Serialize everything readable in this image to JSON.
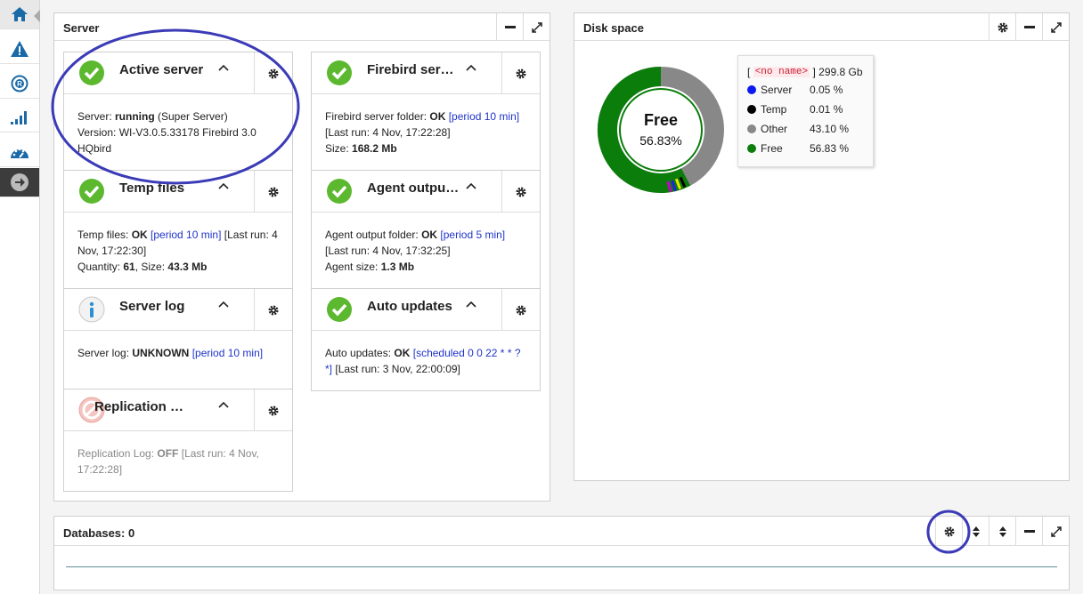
{
  "sidebar": {
    "items": [
      {
        "icon": "home-icon",
        "color": "#1a6aa8"
      },
      {
        "icon": "warning-icon",
        "color": "#1a6aa8"
      },
      {
        "icon": "replication-icon",
        "color": "#1a6aa8"
      },
      {
        "icon": "signal-icon",
        "color": "#1a6aa8"
      },
      {
        "icon": "dashboard-icon",
        "color": "#1a6aa8"
      },
      {
        "icon": "arrow-right-icon",
        "color": "#ffffff"
      }
    ]
  },
  "server_panel": {
    "title": "Server",
    "cards": [
      {
        "title": "Active server",
        "status": "ok",
        "line1_prefix": "Server: ",
        "line1_bold": "running",
        "line1_rest": " (Super Server)",
        "line2": "Version: WI-V3.0.5.33178 Firebird 3.0 HQbird"
      },
      {
        "title": "Firebird ser…",
        "status": "ok",
        "prefix": "Firebird server folder: ",
        "value": "OK",
        "period": "[period 10 min]",
        "lastrun": "[Last run: 4 Nov, 17:22:28]",
        "size_label": "Size: ",
        "size": "168.2 Mb"
      },
      {
        "title": "Temp files",
        "status": "ok",
        "prefix": "Temp files: ",
        "value": "OK",
        "period": "[period 10 min]",
        "lastrun": "[Last run: 4 Nov, 17:22:30]",
        "qty_label": "Quantity: ",
        "qty": "61",
        "size_label": ", Size: ",
        "size": "43.3 Mb"
      },
      {
        "title": "Agent outpu…",
        "status": "ok",
        "prefix": "Agent output folder: ",
        "value": "OK",
        "period": "[period 5 min]",
        "lastrun": "[Last run: 4 Nov, 17:32:25]",
        "size_label": "Agent size: ",
        "size": "1.3 Mb"
      },
      {
        "title": "Server log",
        "status": "info",
        "prefix": "Server log: ",
        "value": "UNKNOWN",
        "period": "[period 10 min]"
      },
      {
        "title": "Auto updates",
        "status": "ok",
        "prefix": "Auto updates: ",
        "value": "OK",
        "period": "[scheduled 0 0 22 * * ? *]",
        "lastrun": "[Last run: 3 Nov, 22:00:09]"
      },
      {
        "title": "Replication …",
        "status": "off",
        "prefix": "Replication Log: ",
        "value": "OFF",
        "lastrun": "[Last run: 4 Nov, 17:22:28]"
      }
    ]
  },
  "disk_panel": {
    "title": "Disk space",
    "center_label": "Free",
    "center_value": "56.83%",
    "legend_header_open": "[",
    "legend_header_tag": "<no name>",
    "legend_header_close": "]",
    "legend_total": "299.8 Gb",
    "items": [
      {
        "name": "Server",
        "value": "0.05 %",
        "color": "#0b1af0"
      },
      {
        "name": "Temp",
        "value": "0.01 %",
        "color": "#000000"
      },
      {
        "name": "Other",
        "value": "43.10 %",
        "color": "#888888"
      },
      {
        "name": "Free",
        "value": "56.83 %",
        "color": "#0a7d0a"
      }
    ]
  },
  "databases_panel": {
    "title": "Databases: 0"
  }
}
